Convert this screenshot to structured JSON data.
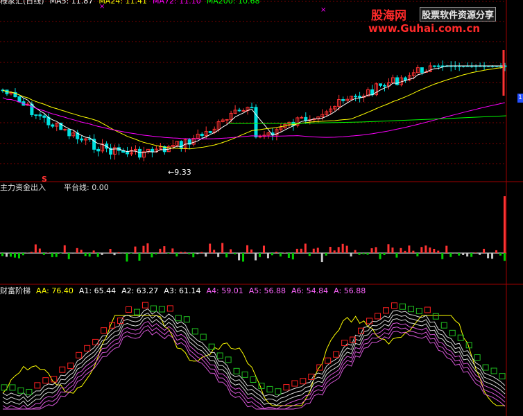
{
  "top_legend": {
    "name": "様家汇(日线)",
    "ma5": "MA5: 11.87",
    "ma24": "MA24: 11.41",
    "ma72": "MA72: 11.10",
    "ma200": "MA200: 10.68"
  },
  "mid_legend": {
    "name": "主力资金出入",
    "line": "平台线: 0.00"
  },
  "bot_legend": {
    "name": "财富阶梯",
    "aa": "AA: 76.40",
    "a1": "A1: 65.44",
    "a2": "A2: 63.27",
    "a3": "A3: 61.14",
    "a4": "A4: 59.01",
    "a5": "A5: 56.88",
    "a6": "A6: 54.84",
    "a": "A: 56.88"
  },
  "watermark": {
    "site": "股海网",
    "tagline": "股票软件资源分享",
    "url": "www.Guhai.com.cn"
  },
  "badge": "1",
  "colors": {
    "up": "#ff3232",
    "down": "#00e0e0",
    "flow_down": "#00d000",
    "flow_grey": "#c8c8c8",
    "ma5": "#ffffff",
    "ma24": "#ffff00",
    "ma72": "#ff00ff",
    "ma200": "#00ff00",
    "aa": "#ffff00",
    "grid": "#7a0000",
    "ladder_up": "#ff2020",
    "ladder_down": "#20c020"
  },
  "chart_data": {
    "type": "candlestick",
    "low_annotation": {
      "label": "←9.33",
      "value": 9.33
    },
    "signal_marker": "S",
    "panes": [
      "price",
      "main_money_flow",
      "wealth_ladder"
    ],
    "flow_baseline": 0.0
  }
}
